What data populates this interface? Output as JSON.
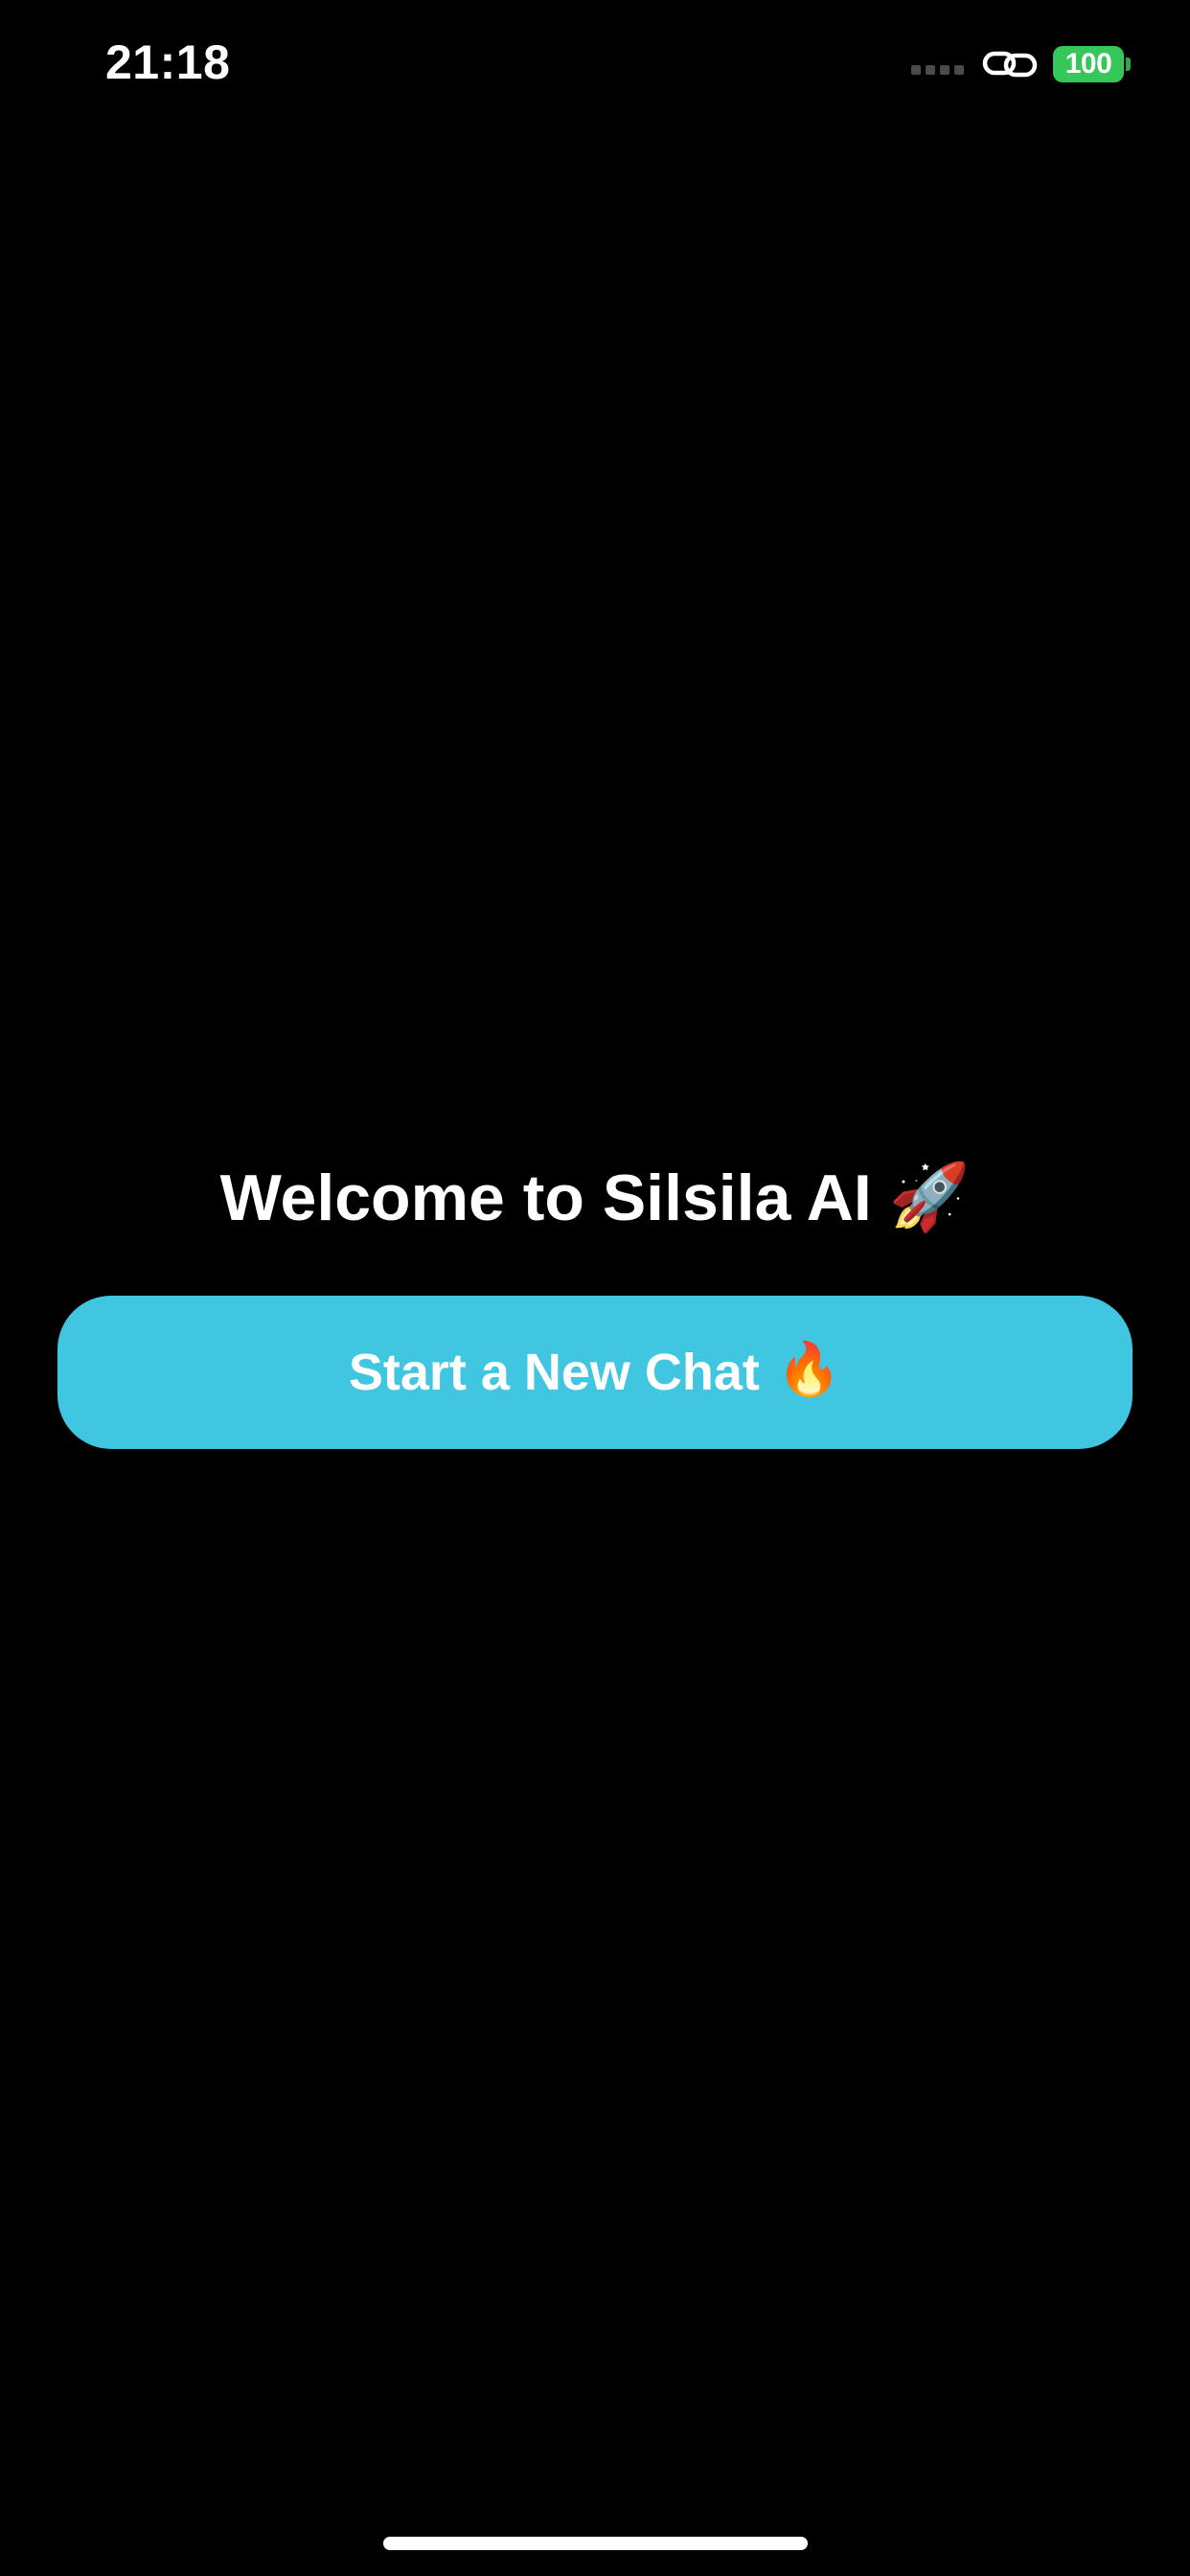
{
  "status_bar": {
    "time": "21:18",
    "battery_level": "100",
    "icons": [
      "signal-dots-icon",
      "link-icon",
      "battery-icon"
    ],
    "battery_color": "#35c759"
  },
  "welcome": {
    "title": "Welcome to Silsila AI",
    "emoji": "🚀"
  },
  "start_button": {
    "label": "Start a New Chat",
    "emoji": "🔥",
    "color": "#40c6e0"
  },
  "colors": {
    "background": "#000000",
    "text": "#ffffff"
  }
}
